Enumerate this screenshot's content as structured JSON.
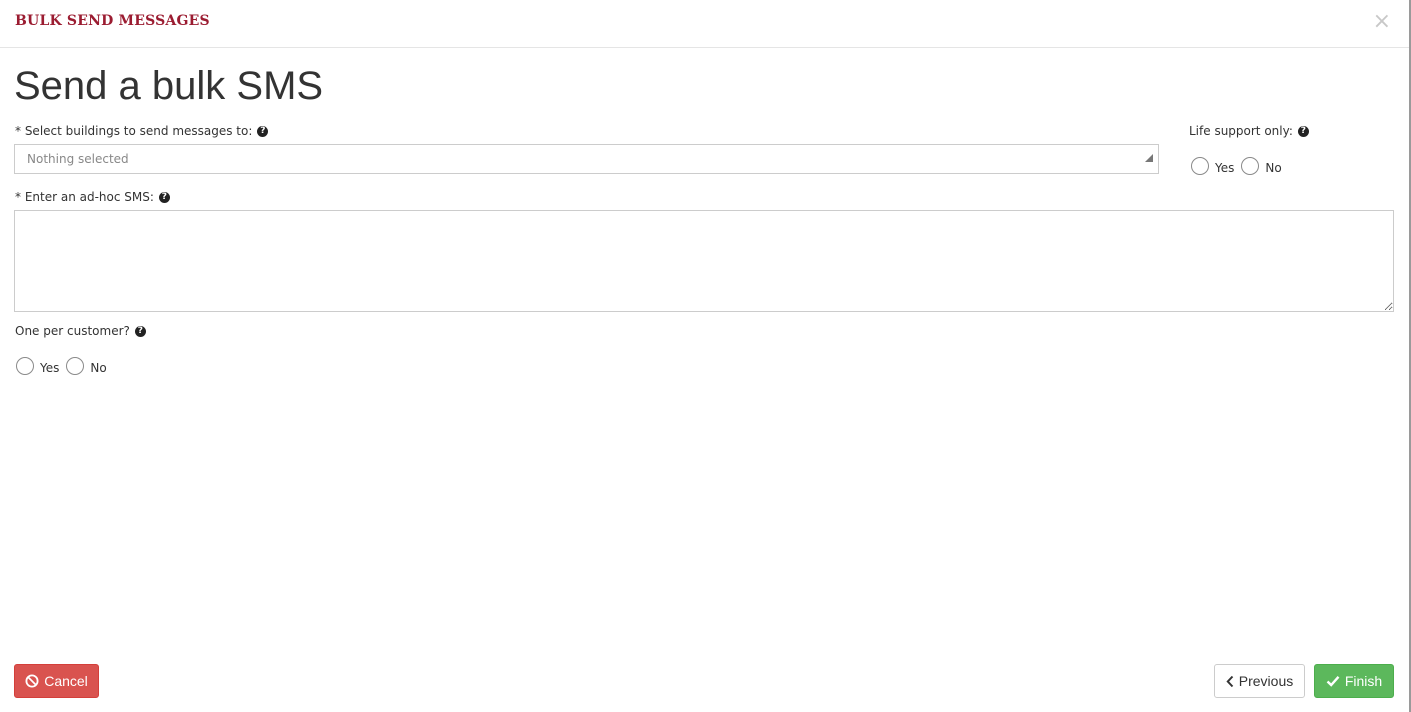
{
  "modal": {
    "title": "BULK SEND MESSAGES",
    "close_glyph": "×"
  },
  "page_title": "Send a bulk SMS",
  "buildings": {
    "label": "* Select buildings to send messages to:",
    "placeholder": "Nothing selected"
  },
  "life_support": {
    "label": "Life support only:",
    "options": [
      "Yes",
      "No"
    ]
  },
  "sms": {
    "label": "* Enter an ad-hoc SMS:",
    "value": ""
  },
  "one_per_customer": {
    "label": "One per customer?",
    "options": [
      "Yes",
      "No"
    ]
  },
  "buttons": {
    "cancel": "Cancel",
    "previous": "Previous",
    "finish": "Finish"
  },
  "icons": {
    "help": "?",
    "cancel": "ban-icon",
    "previous": "chevron-left-icon",
    "finish": "check-icon"
  },
  "colors": {
    "title": "#9b1c31",
    "danger": "#d9534f",
    "success": "#5cb85c"
  }
}
